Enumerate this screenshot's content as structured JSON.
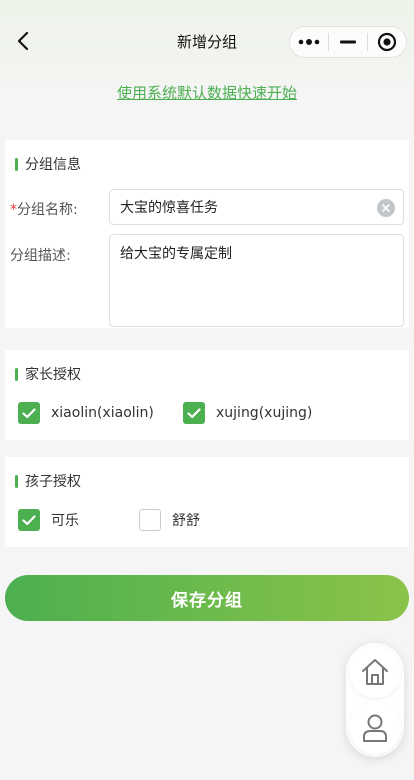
{
  "navbar": {
    "title": "新增分组",
    "back_icon": "chevron-left-icon",
    "capsule_icons": [
      "more-dots-icon",
      "minimize-icon",
      "record-target-icon"
    ]
  },
  "quickstart_link": "使用系统默认数据快速开始",
  "group_info": {
    "section_title": "分组信息",
    "name_label": "分组名称:",
    "required_mark": "*",
    "name_value": "大宝的惊喜任务",
    "desc_label": "分组描述:",
    "desc_value": "给大宝的专属定制"
  },
  "parent_auth": {
    "section_title": "家长授权",
    "items": [
      {
        "label": "xiaolin(xiaolin)",
        "checked": true
      },
      {
        "label": "xujing(xujing)",
        "checked": true
      }
    ]
  },
  "child_auth": {
    "section_title": "孩子授权",
    "items": [
      {
        "label": "可乐",
        "checked": true
      },
      {
        "label": "舒舒",
        "checked": false
      }
    ]
  },
  "save_button": "保存分组",
  "float_panel": {
    "icons": [
      "home-icon",
      "user-icon"
    ]
  },
  "colors": {
    "accent": "#4caf50",
    "gradient_end": "#8bc34a",
    "required": "#e53935"
  }
}
